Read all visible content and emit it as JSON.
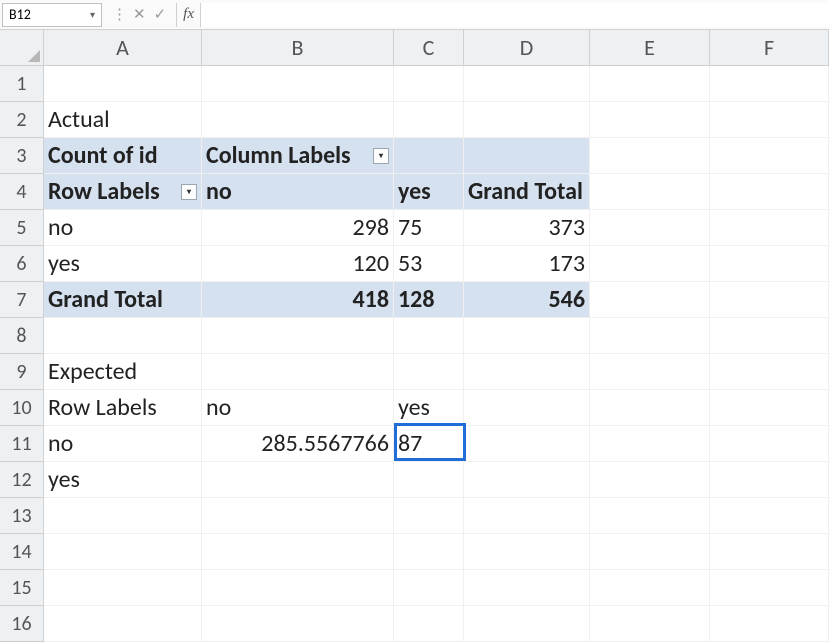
{
  "namebox": "B12",
  "formula": "",
  "columns": [
    "A",
    "B",
    "C",
    "D",
    "E",
    "F"
  ],
  "rows": [
    "1",
    "2",
    "3",
    "4",
    "5",
    "6",
    "7",
    "8",
    "9",
    "10",
    "11",
    "12",
    "13",
    "14",
    "15",
    "16"
  ],
  "cells": {
    "A2": "Actual",
    "A3": "Count of id",
    "B3": "Column Labels",
    "A4": "Row Labels",
    "B4": "no",
    "C4": "yes",
    "D4": "Grand Total",
    "A5": "no",
    "B5": "298",
    "C5": "75",
    "D5": "373",
    "A6": "yes",
    "B6": "120",
    "C6": "53",
    "D6": "173",
    "A7": "Grand Total",
    "B7": "418",
    "C7": "128",
    "D7": "546",
    "A9": "Expected",
    "A10": "Row Labels",
    "B10": "no",
    "C10": "yes",
    "A11": "no",
    "B11": "285.5567766",
    "C11": "87",
    "A12": "yes"
  },
  "selected_cell": "C11",
  "chart_data": {
    "type": "table",
    "title": "Pivot crosstab and expected counts",
    "actual": {
      "row_field": "Row Labels",
      "col_field": "Column Labels",
      "categories_row": [
        "no",
        "yes"
      ],
      "categories_col": [
        "no",
        "yes"
      ],
      "matrix": [
        [
          298,
          75
        ],
        [
          120,
          53
        ]
      ],
      "row_totals": [
        373,
        173
      ],
      "col_totals": [
        418,
        128
      ],
      "grand_total": 546
    },
    "expected": {
      "categories_row": [
        "no",
        "yes"
      ],
      "categories_col": [
        "no",
        "yes"
      ],
      "matrix_partial": [
        [
          285.5567766,
          87
        ],
        [
          null,
          null
        ]
      ]
    }
  }
}
